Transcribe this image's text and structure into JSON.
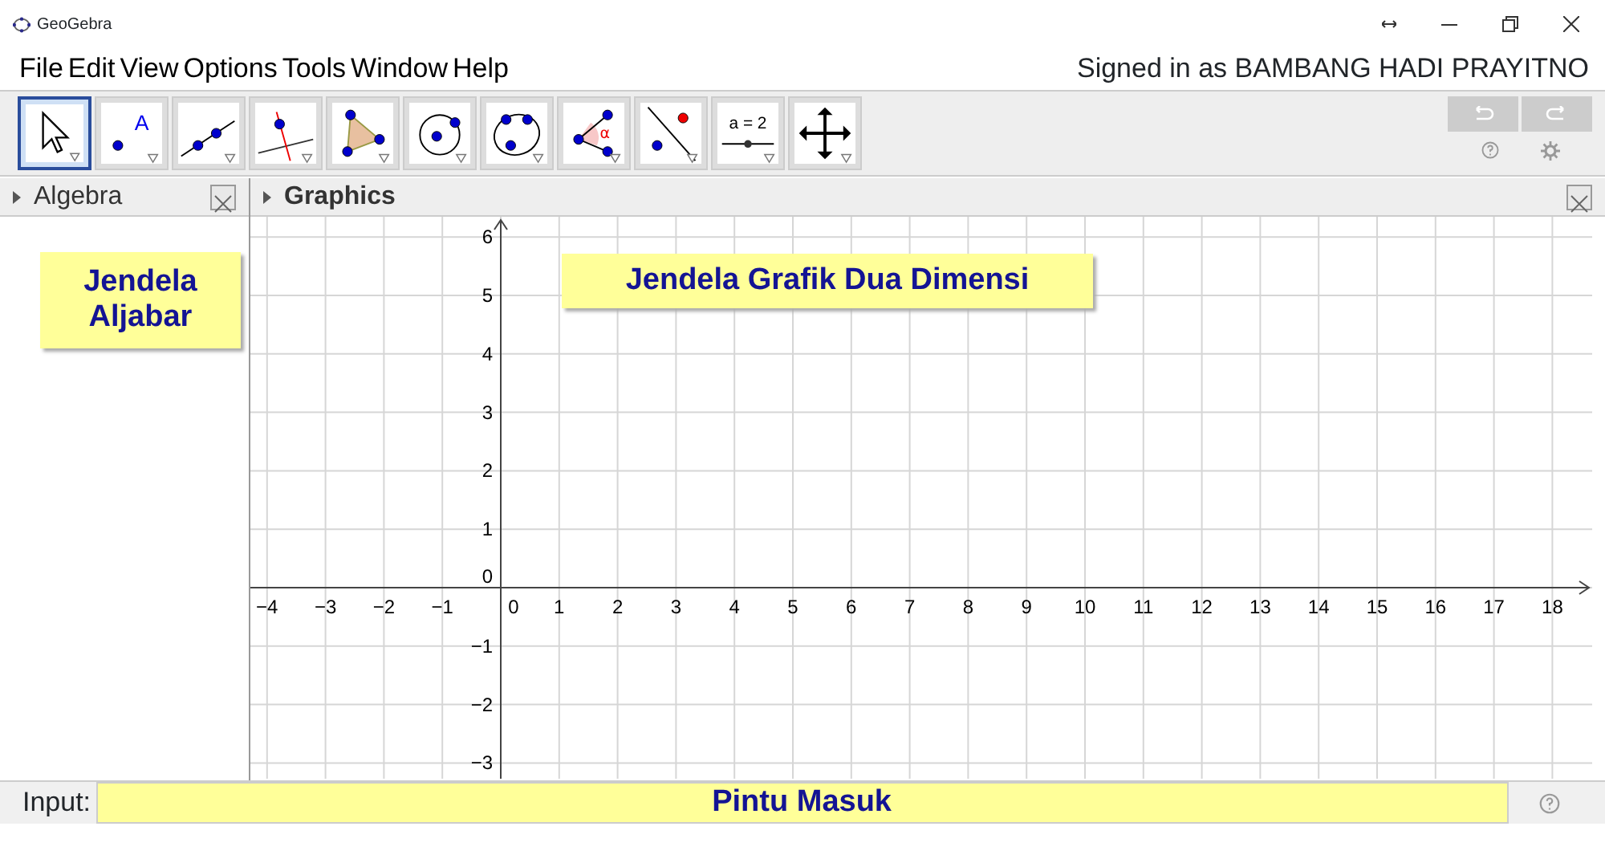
{
  "window": {
    "title": "GeoGebra"
  },
  "menu": [
    {
      "label": "File"
    },
    {
      "label": "Edit"
    },
    {
      "label": "View"
    },
    {
      "label": "Options"
    },
    {
      "label": "Tools"
    },
    {
      "label": "Window"
    },
    {
      "label": "Help"
    }
  ],
  "account": "Signed in as BAMBANG HADI PRAYITNO",
  "tools": [
    {
      "kind": "move",
      "selected": true
    },
    {
      "kind": "point",
      "label": "A",
      "selected": false
    },
    {
      "kind": "line",
      "selected": false
    },
    {
      "kind": "perpendicular",
      "selected": false
    },
    {
      "kind": "polygon",
      "selected": false
    },
    {
      "kind": "circle",
      "selected": false
    },
    {
      "kind": "conic",
      "selected": false
    },
    {
      "kind": "angle",
      "label": "α",
      "selected": false
    },
    {
      "kind": "reflect",
      "selected": false
    },
    {
      "kind": "slider",
      "label": "a = 2",
      "selected": false
    },
    {
      "kind": "pan",
      "selected": false
    }
  ],
  "algebra": {
    "title": "Algebra",
    "note": "Jendela Aljabar"
  },
  "graphics": {
    "title": "Graphics",
    "note": "Jendela Grafik Dua Dimensi",
    "x_labels": [
      "−4",
      "−3",
      "−2",
      "−1",
      "0",
      "1",
      "2",
      "3",
      "4",
      "5",
      "6",
      "7",
      "8",
      "9",
      "10",
      "11",
      "12",
      "13",
      "14",
      "15",
      "16",
      "17",
      "18"
    ],
    "y_labels": [
      "6",
      "5",
      "4",
      "3",
      "2",
      "1",
      "0",
      "−1",
      "−2",
      "−3"
    ]
  },
  "input_bar": {
    "label": "Input:",
    "value": "Pintu Masuk"
  }
}
